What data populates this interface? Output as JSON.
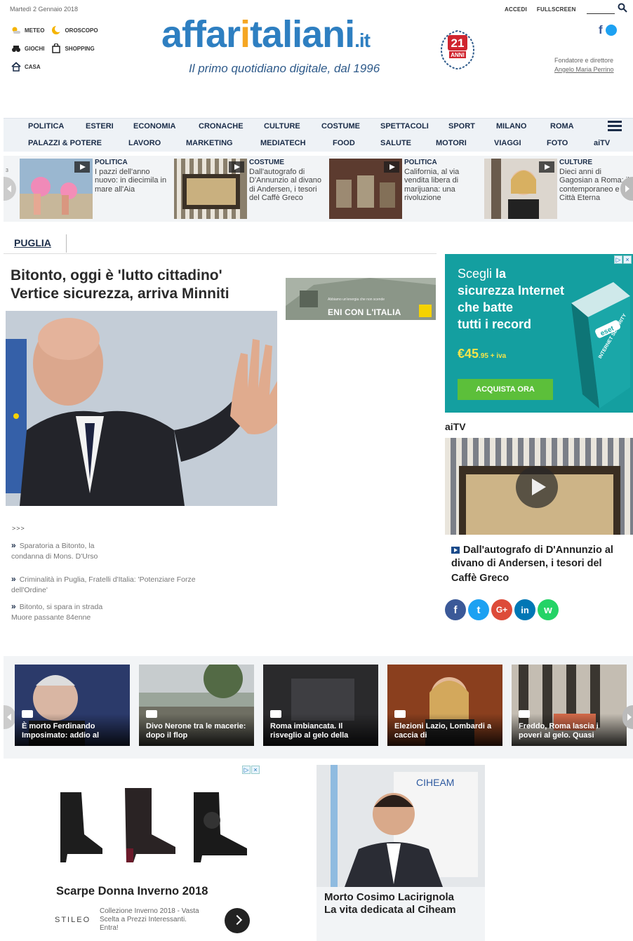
{
  "header": {
    "date": "Martedì 2 Gennaio 2018",
    "links": [
      "ACCEDI",
      "FULLSCREEN"
    ],
    "logo_main_a": "affar",
    "logo_accent": "i",
    "logo_main_b": "taliani",
    "logo_tld": ".it",
    "tagline": "Il primo quotidiano digitale, dal 1996",
    "anni_number": "21",
    "anni_label": "ANNI",
    "founder_label": "Fondatore e direttore",
    "founder_name": "Angelo Maria Perrino",
    "quick_links": [
      "METEO",
      "OROSCOPO",
      "GIOCHI",
      "SHOPPING",
      "CASA"
    ]
  },
  "nav": {
    "row1": [
      "POLITICA",
      "ESTERI",
      "ECONOMIA",
      "CRONACHE",
      "CULTURE",
      "COSTUME",
      "SPETTACOLI",
      "SPORT",
      "MILANO",
      "ROMA"
    ],
    "row2": [
      "PALAZZI & POTERE",
      "LAVORO",
      "MARKETING",
      "MEDIATECH",
      "FOOD",
      "SALUTE",
      "MOTORI",
      "VIAGGI",
      "FOTO",
      "aiTV"
    ]
  },
  "top_carousel": [
    {
      "category": "POLITICA",
      "text": "I pazzi dell'anno nuovo: in diecimila in mare all'Aia"
    },
    {
      "category": "COSTUME",
      "text": "Dall'autografo di D'Annunzio al divano di Andersen, i tesori del Caffè Greco"
    },
    {
      "category": "POLITICA",
      "text": "California, al via vendita libera di marijuana: una rivoluzione"
    },
    {
      "category": "CULTURE",
      "text": "Dieci anni di Gagosian a Roma: il contemporaneo e la Città Eterna"
    }
  ],
  "carousel_index": "3",
  "section": "PUGLIA",
  "article": {
    "headline_1": "Bitonto, oggi è 'lutto cittadino'",
    "headline_2": "Vertice sicurezza, arriva Minniti",
    "more": ">>>",
    "related": [
      [
        "Sparatoria a Bitonto, la",
        "condanna di Mons. D'Urso"
      ],
      [
        "Criminalità in Puglia, Fratelli d'Italia: 'Potenziare Forze",
        "dell'Ordine'"
      ],
      [
        "Bitonto, si spara in strada",
        "Muore passante 84enne"
      ]
    ]
  },
  "eni_ad": {
    "text": "ENI CON L'ITALIA",
    "small": "Abbiamo un'energia che non scende"
  },
  "eset_ad": {
    "line1_pre": "Scegli ",
    "line1_bold": "la",
    "line2": "sicurezza Internet",
    "line3": "che batte",
    "line4": "tutti i record",
    "price": "€45",
    "price_suffix": ".95 + iva",
    "button": "ACQUISTA ORA",
    "box_brand": "eset",
    "box_text": "INTERNET SECURITY"
  },
  "aitv": {
    "label": "aiTV",
    "title": "Dall'autografo di D'Annunzio al divano di Andersen, i tesori del",
    "subtitle": "Caffè Greco"
  },
  "share": [
    "f",
    "t",
    "G+",
    "in",
    "w"
  ],
  "bottom_carousel": [
    {
      "title": "È morto Ferdinando Imposimato: addio al"
    },
    {
      "title": "Divo Nerone tra le macerie: dopo il flop"
    },
    {
      "title": "Roma imbiancata. Il risveglio al gelo della"
    },
    {
      "title": "Elezioni Lazio, Lombardi a caccia di"
    },
    {
      "title": "Freddo, Roma lascia i poveri al gelo. Quasi"
    }
  ],
  "shoes_ad": {
    "title": "Scarpe Donna Inverno 2018",
    "brand": "STILEO",
    "desc": "Collezione Inverno 2018 - Vasta Scelta a Prezzi Interessanti. Entra!"
  },
  "cihe": {
    "line1": "Morto Cosimo Lacirignola",
    "line2": "La vita dedicata al Ciheam",
    "banner": "CIHEAM"
  }
}
